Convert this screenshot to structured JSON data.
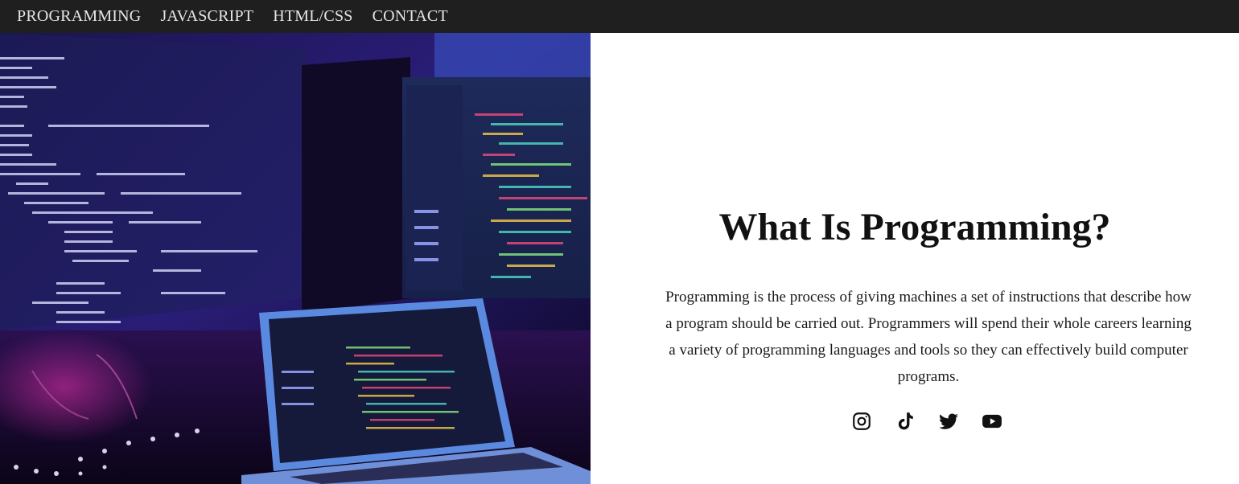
{
  "nav": {
    "items": [
      {
        "label": "PROGRAMMING"
      },
      {
        "label": "JAVASCRIPT"
      },
      {
        "label": "HTML/CSS"
      },
      {
        "label": "CONTACT"
      }
    ]
  },
  "hero": {
    "headline": "What Is Programming?",
    "paragraph": "Programming is the process of giving machines a set of instructions that describe how a program should be carried out. Programmers will spend their whole careers learning a variety of programming languages and tools so they can effectively build computer programs."
  },
  "socials": [
    {
      "icon": "instagram-icon"
    },
    {
      "icon": "tiktok-icon"
    },
    {
      "icon": "twitter-icon"
    },
    {
      "icon": "youtube-icon"
    }
  ],
  "colors": {
    "navbar_bg": "#1f1f1f",
    "nav_text": "#e6e6e6",
    "body_text": "#111111"
  }
}
